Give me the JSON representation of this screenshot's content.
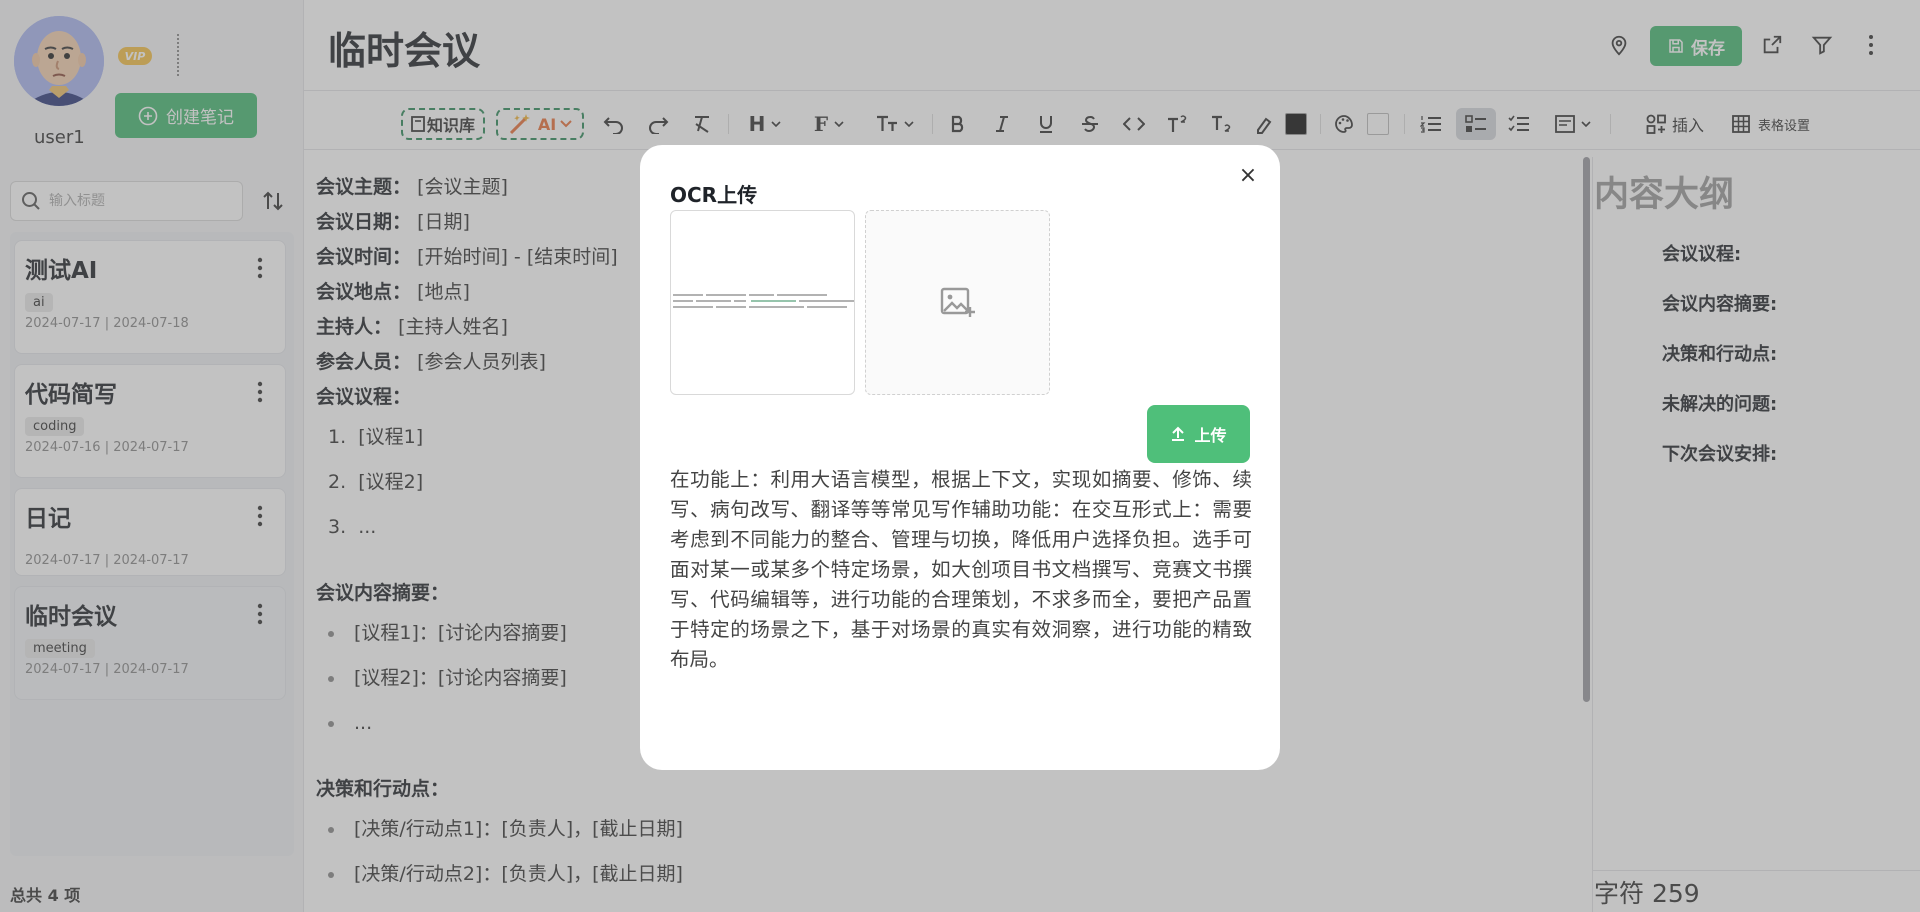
{
  "sidebar": {
    "username": "user1",
    "vip_label": "VIP",
    "create_button": "创建笔记",
    "search_placeholder": "输入标题",
    "total": "总共 4 项",
    "notes": [
      {
        "title": "测试AI",
        "tag": "ai",
        "created": "2024-07-17",
        "updated": "2024-07-18"
      },
      {
        "title": "代码简写",
        "tag": "coding",
        "created": "2024-07-16",
        "updated": "2024-07-17"
      },
      {
        "title": "日记",
        "tag": "",
        "created": "2024-07-17",
        "updated": "2024-07-17"
      },
      {
        "title": "临时会议",
        "tag": "meeting",
        "created": "2024-07-17",
        "updated": "2024-07-17"
      }
    ],
    "date_sep": "|"
  },
  "header": {
    "title": "临时会议",
    "save_label": "保存"
  },
  "toolbar": {
    "kb_label": "知识库",
    "ai_label": "AI",
    "insert_label": "插入",
    "table_settings_label": "表格设置",
    "heading_label": "H",
    "font_label": "F"
  },
  "editor": {
    "fields": [
      {
        "label": "会议主题：",
        "value": "[会议主题]"
      },
      {
        "label": "会议日期：",
        "value": "[日期]"
      },
      {
        "label": "会议时间：",
        "value": "[开始时间] - [结束时间]"
      },
      {
        "label": "会议地点：",
        "value": "[地点]"
      },
      {
        "label": "主持人：",
        "value": "[主持人姓名]"
      },
      {
        "label": "参会人员：",
        "value": "[参会人员列表]"
      }
    ],
    "agenda_heading": "会议议程：",
    "agenda": [
      "[议程1]",
      "[议程2]",
      "..."
    ],
    "summary_heading": "会议内容摘要：",
    "summary": [
      "[议程1]：[讨论内容摘要]",
      "[议程2]：[讨论内容摘要]",
      "..."
    ],
    "actions_heading": "决策和行动点：",
    "actions": [
      "[决策/行动点1]：[负责人]，[截止日期]",
      "[决策/行动点2]：[负责人]，[截止日期]"
    ]
  },
  "outline": {
    "title": "内容大纲",
    "items": [
      "会议议程:",
      "会议内容摘要:",
      "决策和行动点:",
      "未解决的问题:",
      "下次会议安排:"
    ],
    "word_count": "字符 259"
  },
  "modal": {
    "title": "OCR上传",
    "close": "×",
    "upload_label": "上传",
    "text": "在功能上：利用大语言模型，根据上下文，实现如摘要、修饰、续写、病句改写、翻译等等常见写作辅助功能：在交互形式上：需要考虑到不同能力的整合、管理与切换，降低用户选择负担。选手可面对某一或某多个特定场景，如大创项目书文档撰写、竞赛文书撰写、代码编辑等，进行功能的合理策划，不求多而全，要把产品置于特定的场景之下，基于对场景的真实有效洞察，进行功能的精致布局。"
  },
  "colors": {
    "accent": "#46b873",
    "ai": "#e8703a",
    "dashed_border": "#2e8a5a"
  }
}
